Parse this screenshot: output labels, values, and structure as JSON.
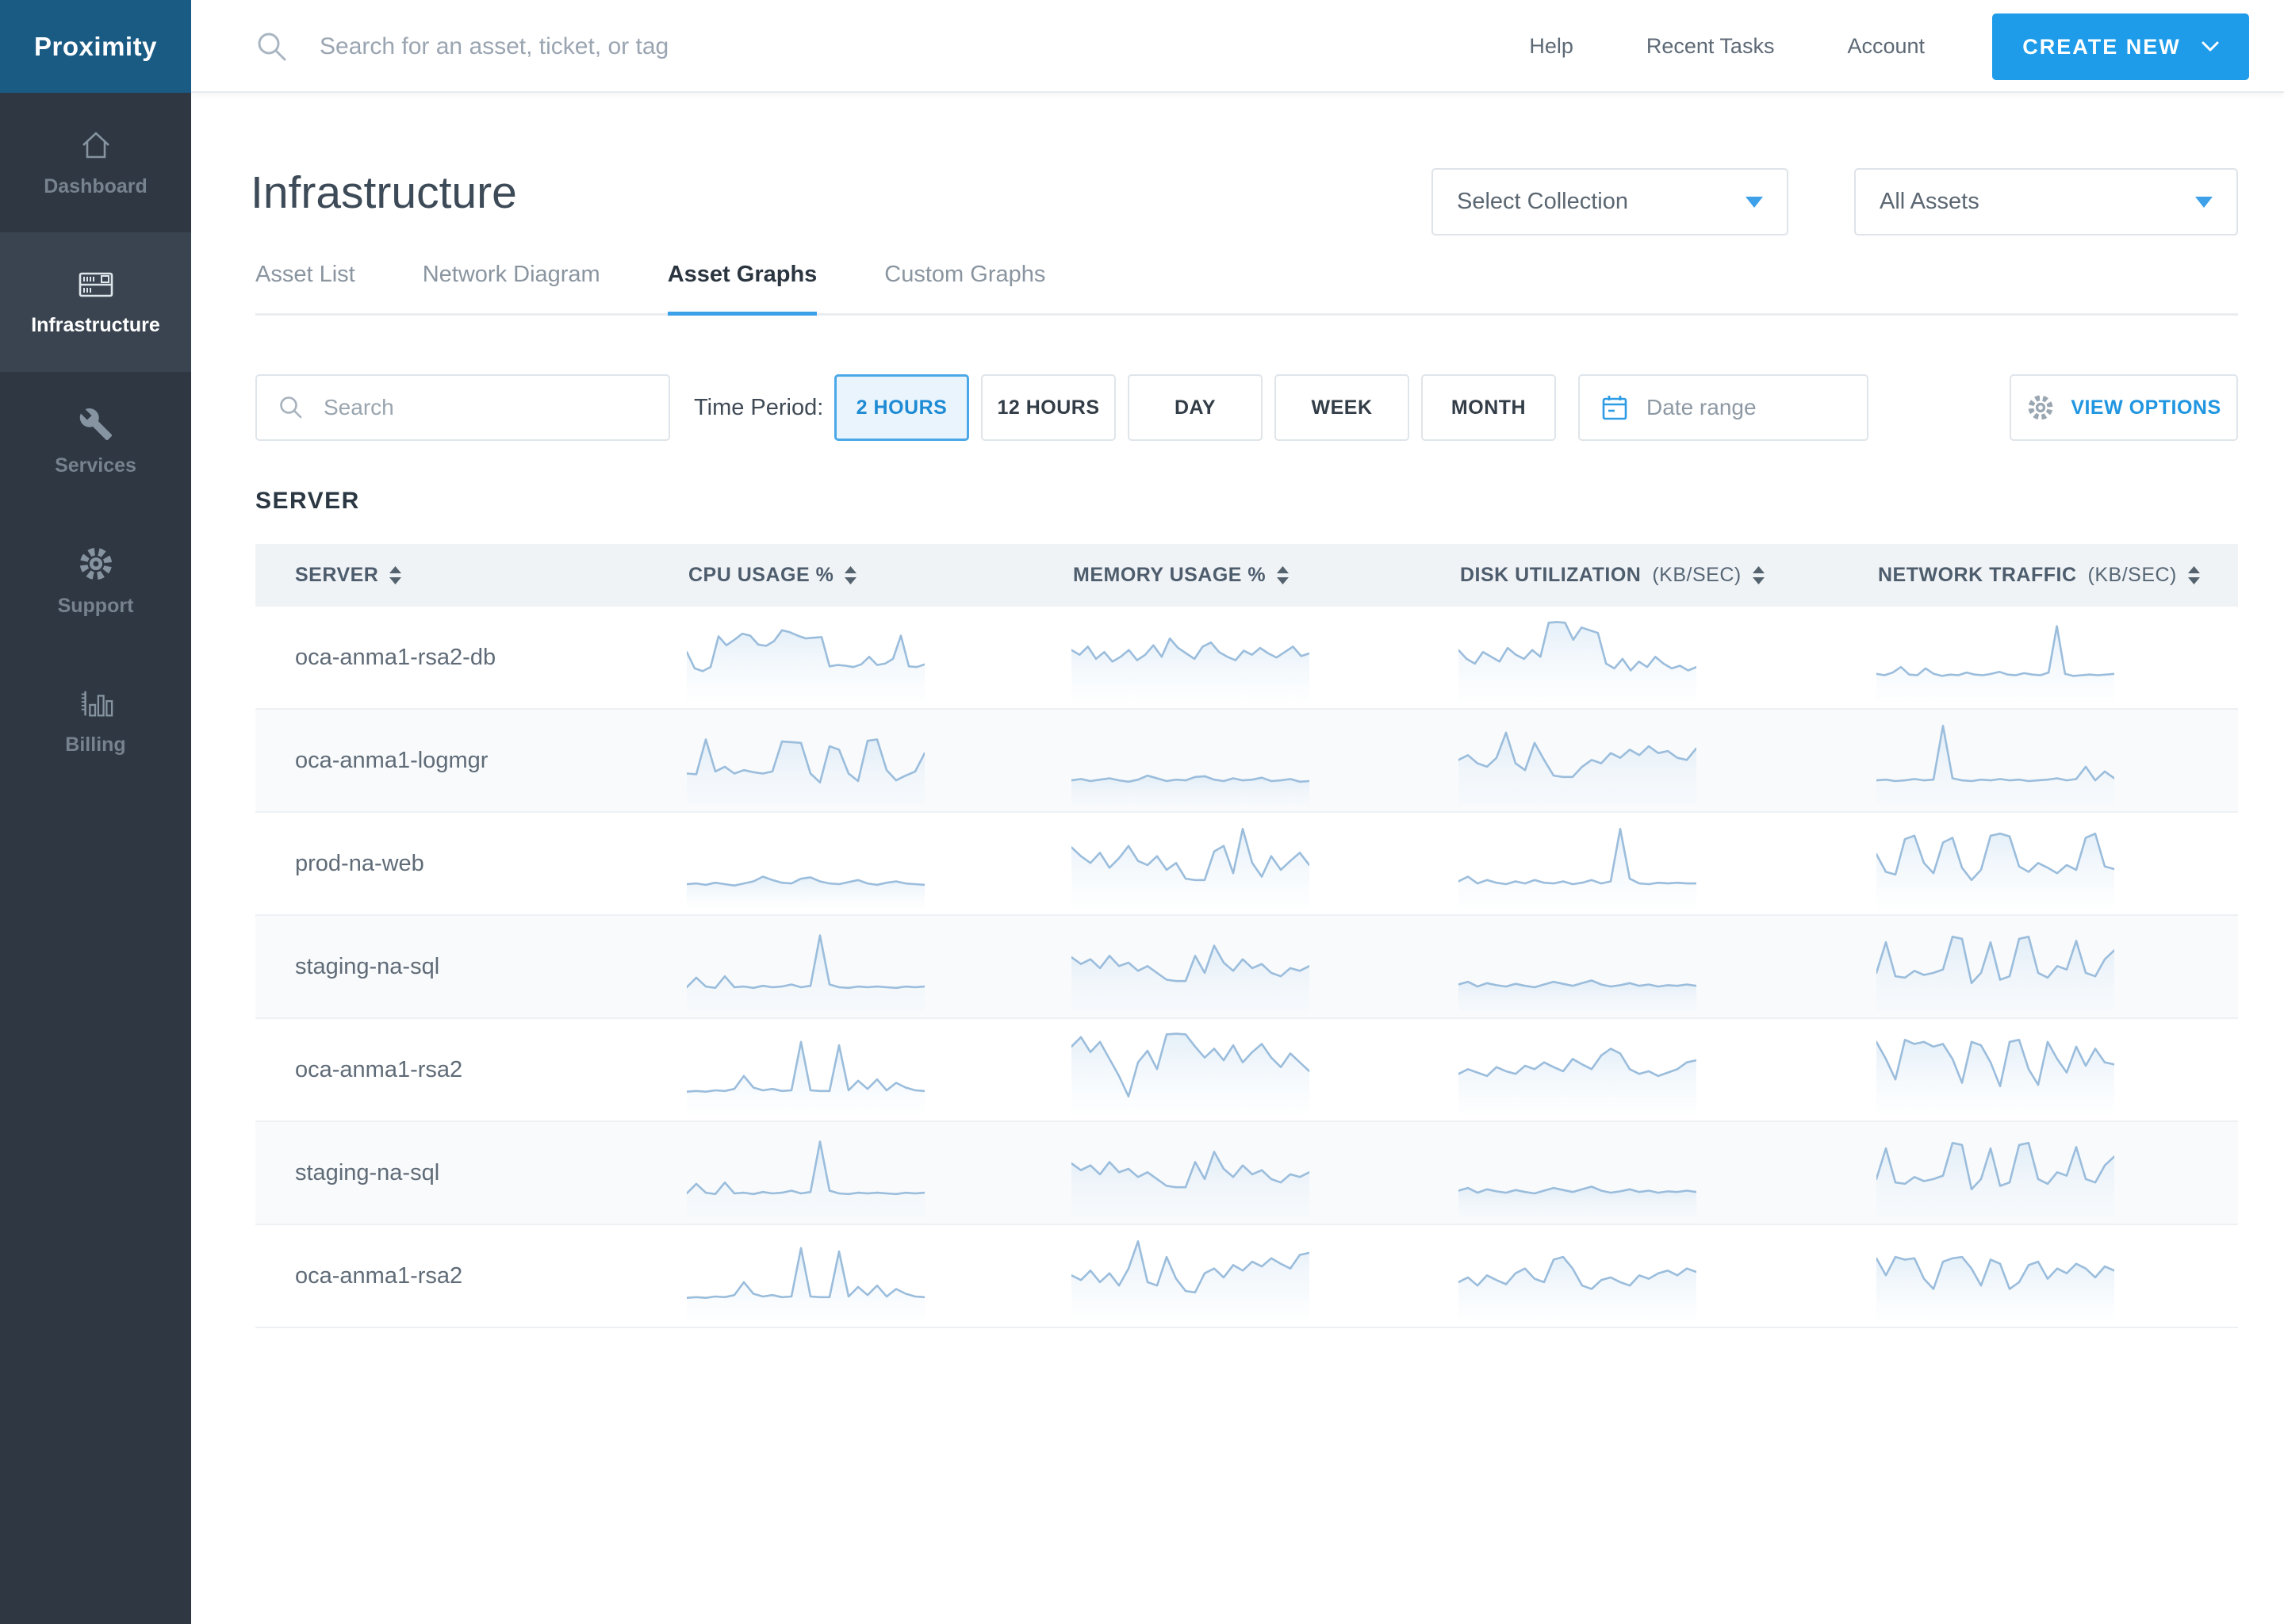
{
  "brand": {
    "logo_text": "Proximity"
  },
  "sidebar": {
    "items": [
      {
        "label": "Dashboard",
        "icon": "home-icon",
        "active": false
      },
      {
        "label": "Infrastructure",
        "icon": "server-rack-icon",
        "active": true
      },
      {
        "label": "Services",
        "icon": "wrench-icon",
        "active": false
      },
      {
        "label": "Support",
        "icon": "gear-icon",
        "active": false
      },
      {
        "label": "Billing",
        "icon": "bar-chart-icon",
        "active": false
      }
    ]
  },
  "topbar": {
    "search_placeholder": "Search for an asset, ticket, or tag",
    "links": [
      {
        "label": "Help"
      },
      {
        "label": "Recent Tasks"
      },
      {
        "label": "Account"
      }
    ],
    "create_button": {
      "label": "CREATE NEW"
    }
  },
  "page": {
    "title": "Infrastructure",
    "collection_dropdown": "Select Collection",
    "assets_dropdown": "All Assets",
    "tabs": [
      {
        "label": "Asset List",
        "active": false
      },
      {
        "label": "Network Diagram",
        "active": false
      },
      {
        "label": "Asset Graphs",
        "active": true
      },
      {
        "label": "Custom Graphs",
        "active": false
      }
    ]
  },
  "filters": {
    "search_placeholder": "Search",
    "time_period_label": "Time Period:",
    "periods": [
      {
        "label": "2 HOURS",
        "active": true
      },
      {
        "label": "12 HOURS",
        "active": false
      },
      {
        "label": "DAY",
        "active": false
      },
      {
        "label": "WEEK",
        "active": false
      },
      {
        "label": "MONTH",
        "active": false
      }
    ],
    "date_range_placeholder": "Date range",
    "view_options_label": "VIEW OPTIONS"
  },
  "section_title": "SERVER",
  "table": {
    "columns": [
      {
        "label": "SERVER",
        "unit": ""
      },
      {
        "label": "CPU USAGE %",
        "unit": ""
      },
      {
        "label": "MEMORY USAGE %",
        "unit": ""
      },
      {
        "label": "DISK UTILIZATION",
        "unit": "(KB/SEC)"
      },
      {
        "label": "NETWORK TRAFFIC",
        "unit": "(KB/SEC)"
      }
    ]
  },
  "colors": {
    "brand_blue": "#1a5b84",
    "sidebar_bg": "#2e3742",
    "sidebar_active_bg": "#3a4450",
    "accent_blue": "#1e9be9",
    "tab_underline": "#3ba1e8",
    "active_period_border": "#4aa8e8",
    "active_period_bg": "#eaf4fc",
    "sparkline_stroke": "#9bbddc",
    "sparkline_fill": "#cfe3f3",
    "table_header_bg": "#f0f3f6",
    "alt_row_bg": "#f8fafc"
  },
  "chart_data": {
    "type": "line",
    "description": "Per-server 2-hour sparklines, values normalized 0-100 (no axes shown in UI)",
    "legend_position": "none",
    "grid": false,
    "metrics": [
      "cpu",
      "memory",
      "disk",
      "network"
    ],
    "rows": [
      {
        "server": "oca-anma1-rsa2-db",
        "cpu": [
          52,
          28,
          24,
          30,
          75,
          62,
          70,
          79,
          76,
          63,
          61,
          68,
          84,
          81,
          76,
          72,
          73,
          74,
          31,
          33,
          32,
          30,
          34,
          45,
          33,
          35,
          42,
          76,
          31,
          30,
          34
        ],
        "memory": [
          55,
          48,
          60,
          42,
          52,
          38,
          45,
          55,
          40,
          48,
          62,
          45,
          72,
          58,
          50,
          42,
          60,
          66,
          52,
          45,
          40,
          54,
          48,
          58,
          50,
          44,
          52,
          60,
          46,
          50
        ],
        "disk": [
          55,
          42,
          35,
          52,
          45,
          38,
          58,
          48,
          42,
          55,
          45,
          95,
          96,
          95,
          70,
          88,
          84,
          80,
          35,
          28,
          42,
          25,
          38,
          30,
          45,
          35,
          28,
          32,
          25,
          30
        ],
        "network": [
          20,
          18,
          22,
          30,
          19,
          18,
          28,
          20,
          17,
          19,
          18,
          22,
          19,
          18,
          20,
          23,
          19,
          18,
          21,
          19,
          18,
          22,
          90,
          20,
          17,
          18,
          19,
          18,
          19,
          20
        ]
      },
      {
        "server": "oca-anma1-logmgr",
        "cpu": [
          25,
          24,
          75,
          28,
          35,
          25,
          30,
          27,
          25,
          28,
          72,
          71,
          70,
          25,
          12,
          65,
          60,
          25,
          14,
          73,
          75,
          30,
          15,
          22,
          28,
          55
        ],
        "memory": [
          15,
          17,
          14,
          16,
          18,
          15,
          13,
          16,
          22,
          18,
          14,
          16,
          15,
          20,
          21,
          16,
          14,
          18,
          15,
          16,
          19,
          14,
          15,
          17,
          13,
          14
        ],
        "disk": [
          45,
          52,
          40,
          35,
          48,
          85,
          40,
          30,
          70,
          45,
          22,
          20,
          20,
          35,
          45,
          40,
          55,
          48,
          60,
          52,
          65,
          55,
          58,
          48,
          45,
          62
        ],
        "network": [
          15,
          16,
          14,
          15,
          17,
          15,
          16,
          95,
          18,
          15,
          14,
          16,
          15,
          17,
          15,
          16,
          14,
          15,
          16,
          18,
          15,
          17,
          35,
          15,
          28,
          18
        ]
      },
      {
        "server": "prod-na-web",
        "cpu": [
          14,
          15,
          13,
          16,
          14,
          12,
          15,
          18,
          25,
          20,
          16,
          15,
          22,
          24,
          18,
          15,
          14,
          17,
          20,
          15,
          13,
          16,
          18,
          15,
          14,
          13
        ],
        "memory": [
          68,
          55,
          45,
          60,
          38,
          52,
          70,
          48,
          42,
          55,
          35,
          45,
          22,
          20,
          20,
          62,
          70,
          30,
          95,
          45,
          25,
          55,
          35,
          48,
          60,
          42
        ],
        "disk": [
          18,
          25,
          15,
          20,
          16,
          14,
          18,
          15,
          20,
          16,
          15,
          18,
          14,
          16,
          20,
          15,
          18,
          95,
          22,
          15,
          14,
          16,
          15,
          16,
          15,
          15
        ],
        "network": [
          58,
          32,
          28,
          80,
          85,
          45,
          30,
          75,
          82,
          38,
          20,
          35,
          85,
          88,
          84,
          40,
          32,
          45,
          38,
          30,
          42,
          35,
          82,
          88,
          40,
          36
        ]
      },
      {
        "server": "staging-na-sql",
        "cpu": [
          14,
          28,
          15,
          13,
          30,
          14,
          15,
          13,
          16,
          14,
          15,
          18,
          14,
          16,
          90,
          18,
          14,
          13,
          15,
          14,
          15,
          14,
          13,
          15,
          14,
          15
        ],
        "memory": [
          58,
          48,
          55,
          42,
          60,
          45,
          50,
          38,
          45,
          35,
          25,
          23,
          23,
          60,
          35,
          75,
          50,
          38,
          55,
          42,
          48,
          35,
          30,
          42,
          38,
          45
        ],
        "disk": [
          18,
          22,
          15,
          20,
          17,
          15,
          19,
          16,
          14,
          18,
          22,
          19,
          16,
          20,
          24,
          18,
          15,
          17,
          20,
          16,
          18,
          15,
          17,
          16,
          18,
          16
        ],
        "network": [
          35,
          80,
          30,
          28,
          38,
          32,
          35,
          40,
          88,
          85,
          20,
          35,
          80,
          25,
          30,
          85,
          88,
          35,
          28,
          45,
          40,
          82,
          35,
          30,
          55,
          68
        ]
      },
      {
        "server": "oca-anma1-rsa2",
        "cpu": [
          12,
          13,
          12,
          14,
          13,
          16,
          35,
          18,
          14,
          16,
          13,
          14,
          85,
          14,
          13,
          13,
          80,
          14,
          28,
          16,
          30,
          14,
          25,
          18,
          14,
          13
        ],
        "memory": [
          78,
          92,
          70,
          85,
          60,
          35,
          5,
          55,
          72,
          45,
          96,
          97,
          96,
          78,
          62,
          75,
          58,
          80,
          55,
          70,
          82,
          62,
          48,
          68,
          55,
          42
        ],
        "disk": [
          38,
          45,
          40,
          35,
          48,
          42,
          38,
          50,
          45,
          55,
          48,
          42,
          60,
          52,
          45,
          65,
          75,
          68,
          45,
          38,
          42,
          35,
          40,
          45,
          55,
          58
        ],
        "network": [
          85,
          60,
          30,
          88,
          82,
          85,
          78,
          82,
          60,
          25,
          85,
          80,
          55,
          20,
          85,
          88,
          45,
          22,
          85,
          60,
          40,
          78,
          50,
          75,
          55,
          52
        ]
      },
      {
        "server": "staging-na-sql",
        "cpu": [
          14,
          28,
          15,
          13,
          30,
          14,
          15,
          13,
          16,
          14,
          15,
          18,
          14,
          16,
          90,
          18,
          14,
          13,
          15,
          14,
          15,
          14,
          13,
          15,
          14,
          15
        ],
        "memory": [
          58,
          48,
          55,
          42,
          60,
          45,
          50,
          38,
          45,
          35,
          25,
          23,
          23,
          60,
          35,
          75,
          50,
          38,
          55,
          42,
          48,
          35,
          30,
          42,
          38,
          45
        ],
        "disk": [
          18,
          22,
          15,
          20,
          17,
          15,
          19,
          16,
          14,
          18,
          22,
          19,
          16,
          20,
          24,
          18,
          15,
          17,
          20,
          16,
          18,
          15,
          17,
          16,
          18,
          16
        ],
        "network": [
          35,
          80,
          30,
          28,
          38,
          32,
          35,
          40,
          88,
          85,
          20,
          35,
          80,
          25,
          30,
          85,
          88,
          35,
          28,
          45,
          40,
          82,
          35,
          30,
          55,
          68
        ]
      },
      {
        "server": "oca-anma1-rsa2",
        "cpu": [
          12,
          13,
          12,
          14,
          13,
          16,
          35,
          18,
          14,
          16,
          13,
          14,
          85,
          14,
          13,
          13,
          80,
          14,
          28,
          16,
          30,
          14,
          25,
          18,
          14,
          13
        ],
        "memory": [
          45,
          38,
          52,
          35,
          48,
          30,
          55,
          95,
          35,
          30,
          72,
          40,
          22,
          20,
          48,
          55,
          42,
          60,
          52,
          65,
          58,
          70,
          62,
          55,
          75,
          78
        ],
        "disk": [
          35,
          42,
          30,
          45,
          38,
          32,
          48,
          55,
          40,
          35,
          68,
          72,
          55,
          30,
          25,
          38,
          42,
          35,
          30,
          45,
          40,
          48,
          52,
          45,
          55,
          50
        ],
        "network": [
          70,
          45,
          72,
          68,
          70,
          40,
          25,
          65,
          70,
          72,
          55,
          30,
          68,
          62,
          25,
          35,
          60,
          65,
          40,
          55,
          48,
          62,
          55,
          42,
          58,
          52
        ]
      }
    ]
  }
}
